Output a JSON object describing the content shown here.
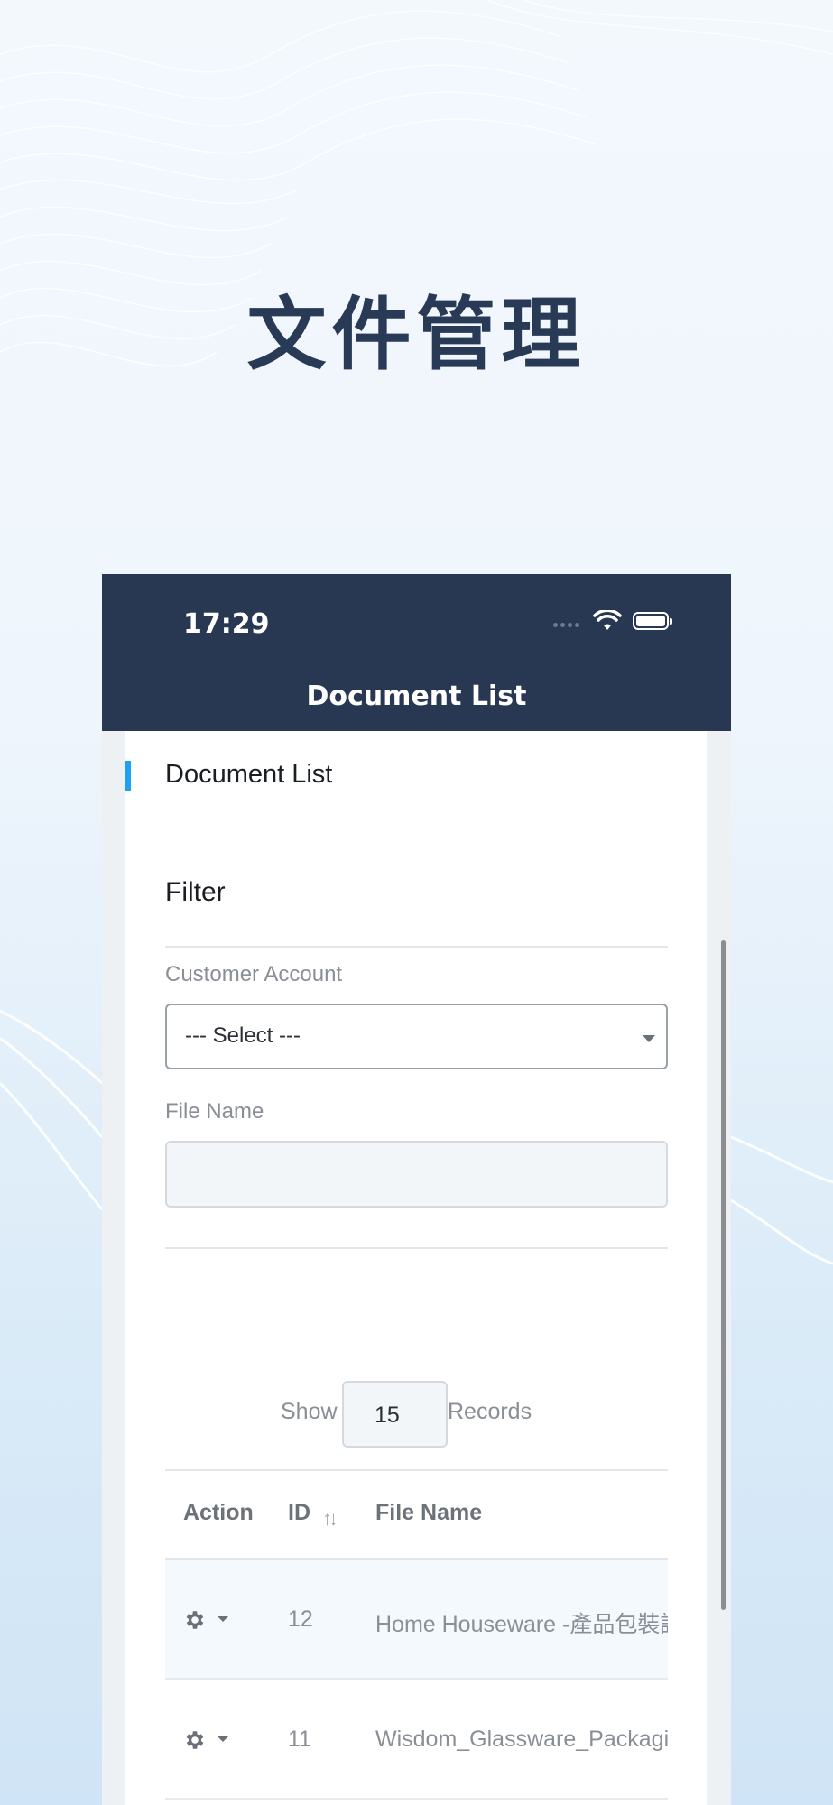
{
  "hero": {
    "title": "文件管理"
  },
  "status_bar": {
    "time": "17:29"
  },
  "nav": {
    "title": "Document List"
  },
  "card": {
    "title": "Document List"
  },
  "filter": {
    "title": "Filter",
    "customer_account_label": "Customer Account",
    "customer_account_value": "--- Select ---",
    "file_name_label": "File Name",
    "file_name_value": ""
  },
  "pagination": {
    "show_label": "Show",
    "records_value": "15",
    "records_label": "Records"
  },
  "table": {
    "headers": {
      "action": "Action",
      "id": "ID",
      "file_name": "File Name",
      "sort_glyph": "↑↓"
    },
    "rows": [
      {
        "id": "12",
        "file_name": "Home Houseware -產品包裝說明"
      },
      {
        "id": "11",
        "file_name": "Wisdom_Glassware_Packaging"
      }
    ]
  },
  "colors": {
    "nav_bg": "#283752",
    "accent": "#1ea1f2",
    "hero_text": "#283a55"
  }
}
